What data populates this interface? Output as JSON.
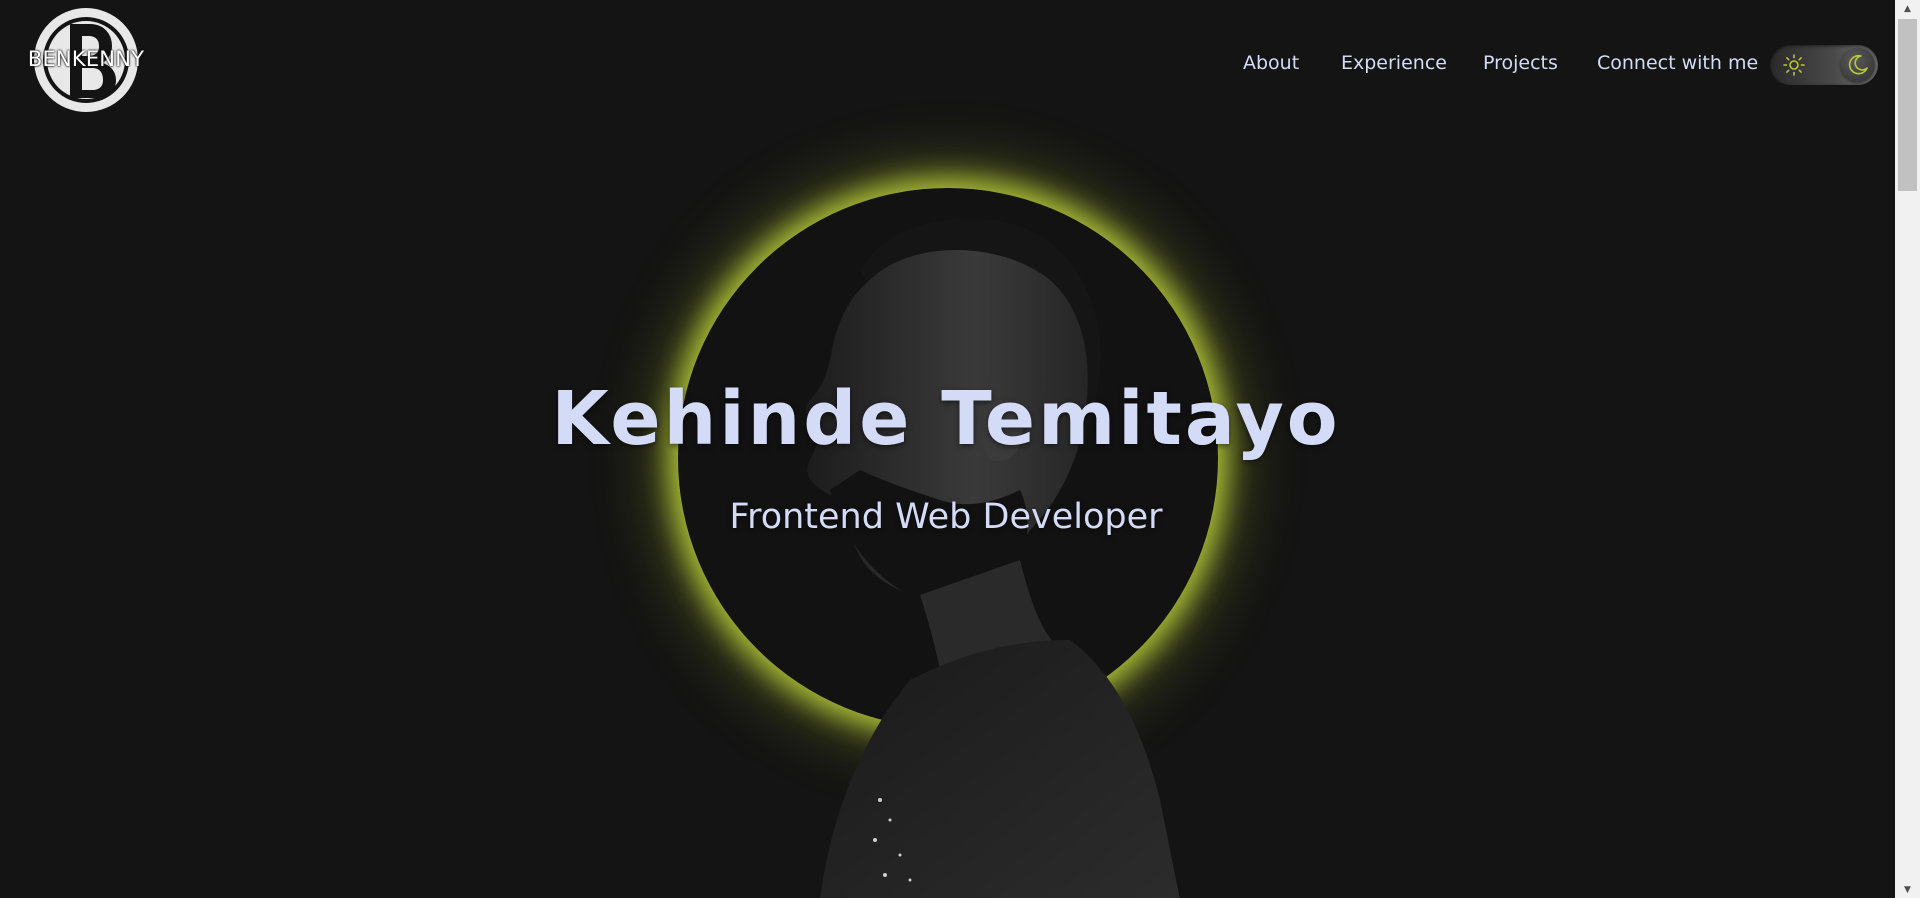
{
  "brand": {
    "logo_text": "BENKENNY",
    "logo_letter": "B"
  },
  "nav": {
    "items": [
      {
        "label": "About"
      },
      {
        "label": "Experience"
      },
      {
        "label": "Projects"
      },
      {
        "label": "Connect with me"
      }
    ]
  },
  "theme_toggle": {
    "left_icon": "sun-icon",
    "right_icon": "moon-icon",
    "mode": "dark"
  },
  "hero": {
    "name": "Kehinde Temitayo",
    "role": "Frontend Web Developer",
    "image": "portrait-photo",
    "accent_color": "#c3d43c"
  },
  "colors": {
    "background": "#141414",
    "text": "#d4dbf7",
    "glow": "#c3d43c"
  }
}
